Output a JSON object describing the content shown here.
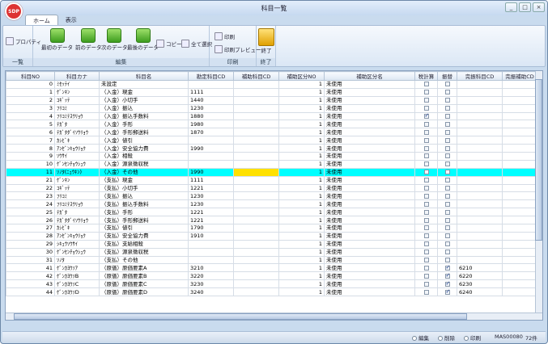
{
  "window": {
    "title": "科目一覧",
    "logo": "SDP"
  },
  "tabs": [
    {
      "label": "ホーム"
    },
    {
      "label": "表示"
    }
  ],
  "ribbon": {
    "property": "プロパティ",
    "group_ichiran": "一覧",
    "first": "最初のデータ",
    "prev": "前のデータ",
    "next": "次のデータ",
    "last": "最後のデータ",
    "copy": "コピー",
    "select_all": "全て選択",
    "group_edit": "編集",
    "print": "印刷",
    "print_preview": "印刷プレビュー",
    "group_print": "印刷",
    "exit": "終了",
    "group_exit": "終了"
  },
  "columns": [
    "科目NO",
    "科目カナ",
    "科目名",
    "勘定科目CD",
    "補助科目CD",
    "補助区分NO",
    "補助区分名",
    "税計算",
    "振替",
    "完振科目CD",
    "完振補助CD"
  ],
  "rows": [
    {
      "no": "0",
      "kana": "ﾐｾｯﾃｲ",
      "name": "未設定",
      "acct": "",
      "sub": "",
      "div": "1",
      "divname": "未使用",
      "tax": false,
      "fur": false,
      "cf": ""
    },
    {
      "no": "1",
      "kana": "ｹﾞﾝｷﾝ",
      "name": "（入金）現金",
      "acct": "1111",
      "sub": "",
      "div": "1",
      "divname": "未使用",
      "tax": false,
      "fur": false,
      "cf": ""
    },
    {
      "no": "2",
      "kana": "ｺｷﾞｯﾃ",
      "name": "（入金）小切手",
      "acct": "1440",
      "sub": "",
      "div": "1",
      "divname": "未使用",
      "tax": false,
      "fur": false,
      "cf": ""
    },
    {
      "no": "3",
      "kana": "ﾌﾘｺﾐ",
      "name": "（入金）振込",
      "acct": "1230",
      "sub": "",
      "div": "1",
      "divname": "未使用",
      "tax": false,
      "fur": false,
      "cf": ""
    },
    {
      "no": "4",
      "kana": "ﾌﾘｺﾐﾃｽｳﾘｮｳ",
      "name": "（入金）振込手数料",
      "acct": "1880",
      "sub": "",
      "div": "1",
      "divname": "未使用",
      "tax": true,
      "fur": false,
      "cf": ""
    },
    {
      "no": "5",
      "kana": "ﾃｶﾞﾀ",
      "name": "（入金）手形",
      "acct": "1980",
      "sub": "",
      "div": "1",
      "divname": "未使用",
      "tax": false,
      "fur": false,
      "cf": ""
    },
    {
      "no": "6",
      "kana": "ﾃｶﾞﾀﾀﾞｲｿｳﾘｮｳ",
      "name": "（入金）手形郵送料",
      "acct": "1870",
      "sub": "",
      "div": "1",
      "divname": "未使用",
      "tax": false,
      "fur": false,
      "cf": ""
    },
    {
      "no": "7",
      "kana": "ｶｼﾋﾞｷ",
      "name": "（入金）値引",
      "acct": "",
      "sub": "",
      "div": "1",
      "divname": "未使用",
      "tax": false,
      "fur": false,
      "cf": ""
    },
    {
      "no": "8",
      "kana": "ｱﾝｾﾞﾝｷｮｳﾘｮｸ",
      "name": "（入金）安全協力費",
      "acct": "1990",
      "sub": "",
      "div": "1",
      "divname": "未使用",
      "tax": false,
      "fur": false,
      "cf": ""
    },
    {
      "no": "9",
      "kana": "ｿｳｻｲ",
      "name": "（入金）相殺",
      "acct": "",
      "sub": "",
      "div": "1",
      "divname": "未使用",
      "tax": false,
      "fur": false,
      "cf": ""
    },
    {
      "no": "10",
      "kana": "ｹﾞﾝｾﾝﾁｮｳｼｭｳ",
      "name": "（入金）源泉徴収税",
      "acct": "",
      "sub": "",
      "div": "1",
      "divname": "未使用",
      "tax": false,
      "fur": false,
      "cf": ""
    },
    {
      "no": "11",
      "kana": "ｿﾉﾀ(ﾆｭｳｷﾝ)",
      "name": "（入金）その他",
      "acct": "1990",
      "sub": "",
      "div": "1",
      "divname": "未使用",
      "tax": false,
      "fur": false,
      "cf": "",
      "selected": true
    },
    {
      "no": "21",
      "kana": "ｹﾞﾝｷﾝ",
      "name": "（支払）現金",
      "acct": "1111",
      "sub": "",
      "div": "1",
      "divname": "未使用",
      "tax": false,
      "fur": false,
      "cf": ""
    },
    {
      "no": "22",
      "kana": "ｺｷﾞｯﾃ",
      "name": "（支払）小切手",
      "acct": "1221",
      "sub": "",
      "div": "1",
      "divname": "未使用",
      "tax": false,
      "fur": false,
      "cf": ""
    },
    {
      "no": "23",
      "kana": "ﾌﾘｺﾐ",
      "name": "（支払）振込",
      "acct": "1230",
      "sub": "",
      "div": "1",
      "divname": "未使用",
      "tax": false,
      "fur": false,
      "cf": ""
    },
    {
      "no": "24",
      "kana": "ﾌﾘｺﾐﾃｽｳﾘｮｳ",
      "name": "（支払）振込手数料",
      "acct": "1230",
      "sub": "",
      "div": "1",
      "divname": "未使用",
      "tax": false,
      "fur": false,
      "cf": ""
    },
    {
      "no": "25",
      "kana": "ﾃｶﾞﾀ",
      "name": "（支払）手形",
      "acct": "1221",
      "sub": "",
      "div": "1",
      "divname": "未使用",
      "tax": false,
      "fur": false,
      "cf": ""
    },
    {
      "no": "26",
      "kana": "ﾃｶﾞﾀﾀﾞｲｿｳﾘｮｳ",
      "name": "（支払）手形郵送料",
      "acct": "1221",
      "sub": "",
      "div": "1",
      "divname": "未使用",
      "tax": false,
      "fur": false,
      "cf": ""
    },
    {
      "no": "27",
      "kana": "ｶｼﾋﾞｷ",
      "name": "（支払）値引",
      "acct": "1790",
      "sub": "",
      "div": "1",
      "divname": "未使用",
      "tax": false,
      "fur": false,
      "cf": ""
    },
    {
      "no": "28",
      "kana": "ｱﾝｾﾞﾝｷｮｳﾘｮｸ",
      "name": "（支払）安全協力費",
      "acct": "1910",
      "sub": "",
      "div": "1",
      "divname": "未使用",
      "tax": false,
      "fur": false,
      "cf": ""
    },
    {
      "no": "29",
      "kana": "ｼｷｭｳｿｳｻｲ",
      "name": "（支払）支給相殺",
      "acct": "",
      "sub": "",
      "div": "1",
      "divname": "未使用",
      "tax": false,
      "fur": false,
      "cf": ""
    },
    {
      "no": "30",
      "kana": "ｹﾞﾝｾﾝﾁｮｳｼｭｳ",
      "name": "（支払）源泉徴収税",
      "acct": "",
      "sub": "",
      "div": "1",
      "divname": "未使用",
      "tax": false,
      "fur": false,
      "cf": ""
    },
    {
      "no": "31",
      "kana": "ｿﾉﾀ",
      "name": "（支払）その他",
      "acct": "",
      "sub": "",
      "div": "1",
      "divname": "未使用",
      "tax": false,
      "fur": false,
      "cf": ""
    },
    {
      "no": "41",
      "kana": "ｹﾞﾝｶﾖｳｿｱ",
      "name": "（原価）原価要素A",
      "acct": "3210",
      "sub": "",
      "div": "1",
      "divname": "未使用",
      "tax": false,
      "fur": true,
      "cf": "6210"
    },
    {
      "no": "42",
      "kana": "ｹﾞﾝｶﾖｳｿB",
      "name": "（原価）原価要素B",
      "acct": "3220",
      "sub": "",
      "div": "1",
      "divname": "未使用",
      "tax": false,
      "fur": true,
      "cf": "6220"
    },
    {
      "no": "43",
      "kana": "ｹﾞﾝｶﾖｳｿC",
      "name": "（原価）原価要素C",
      "acct": "3230",
      "sub": "",
      "div": "1",
      "divname": "未使用",
      "tax": false,
      "fur": true,
      "cf": "6230"
    },
    {
      "no": "44",
      "kana": "ｹﾞﾝｶﾖｳｿD",
      "name": "（原価）原価要素D",
      "acct": "3240",
      "sub": "",
      "div": "1",
      "divname": "未使用",
      "tax": false,
      "fur": true,
      "cf": "6240"
    }
  ],
  "status": {
    "edit": "編集",
    "delete": "削除",
    "print": "印刷",
    "form": "MAS00080",
    "count": "72件"
  }
}
